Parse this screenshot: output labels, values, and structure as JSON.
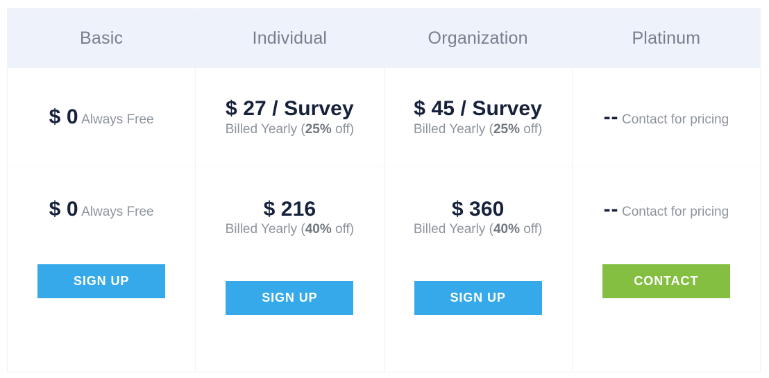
{
  "table": {
    "columns": [
      {
        "id": "basic",
        "header": "Basic",
        "per_survey": {
          "amount": "$ 0",
          "note_prefix": "Always Free",
          "note_strong": "",
          "note_suffix": ""
        },
        "yearly": {
          "amount": "$ 0",
          "note_prefix": "Always Free",
          "note_strong": "",
          "note_suffix": ""
        },
        "cta": {
          "label": "SIGN UP",
          "style": "primary",
          "color": "#35a9ea"
        }
      },
      {
        "id": "individual",
        "header": "Individual",
        "per_survey": {
          "amount": "$ 27 / Survey",
          "note_prefix": "Billed Yearly (",
          "note_strong": "25%",
          "note_suffix": " off)"
        },
        "yearly": {
          "amount": "$ 216",
          "note_prefix": "Billed Yearly (",
          "note_strong": "40%",
          "note_suffix": " off)"
        },
        "cta": {
          "label": "SIGN UP",
          "style": "primary",
          "color": "#35a9ea"
        }
      },
      {
        "id": "organization",
        "header": "Organization",
        "per_survey": {
          "amount": "$ 45 / Survey",
          "note_prefix": "Billed Yearly (",
          "note_strong": "25%",
          "note_suffix": " off)"
        },
        "yearly": {
          "amount": "$ 360",
          "note_prefix": "Billed Yearly (",
          "note_strong": "40%",
          "note_suffix": " off)"
        },
        "cta": {
          "label": "SIGN UP",
          "style": "primary",
          "color": "#35a9ea"
        }
      },
      {
        "id": "platinum",
        "header": "Platinum",
        "per_survey": {
          "amount": "--",
          "note_prefix": "Contact for pricing",
          "note_strong": "",
          "note_suffix": ""
        },
        "yearly": {
          "amount": "--",
          "note_prefix": "Contact for pricing",
          "note_strong": "",
          "note_suffix": ""
        },
        "cta": {
          "label": "CONTACT",
          "style": "success",
          "color": "#84bf41"
        }
      }
    ],
    "theme": {
      "header_bg": "#eef3fb",
      "header_text": "#767f8c",
      "price_text": "#16213b",
      "note_text": "#8d939d",
      "border": "#eef1f8"
    }
  }
}
